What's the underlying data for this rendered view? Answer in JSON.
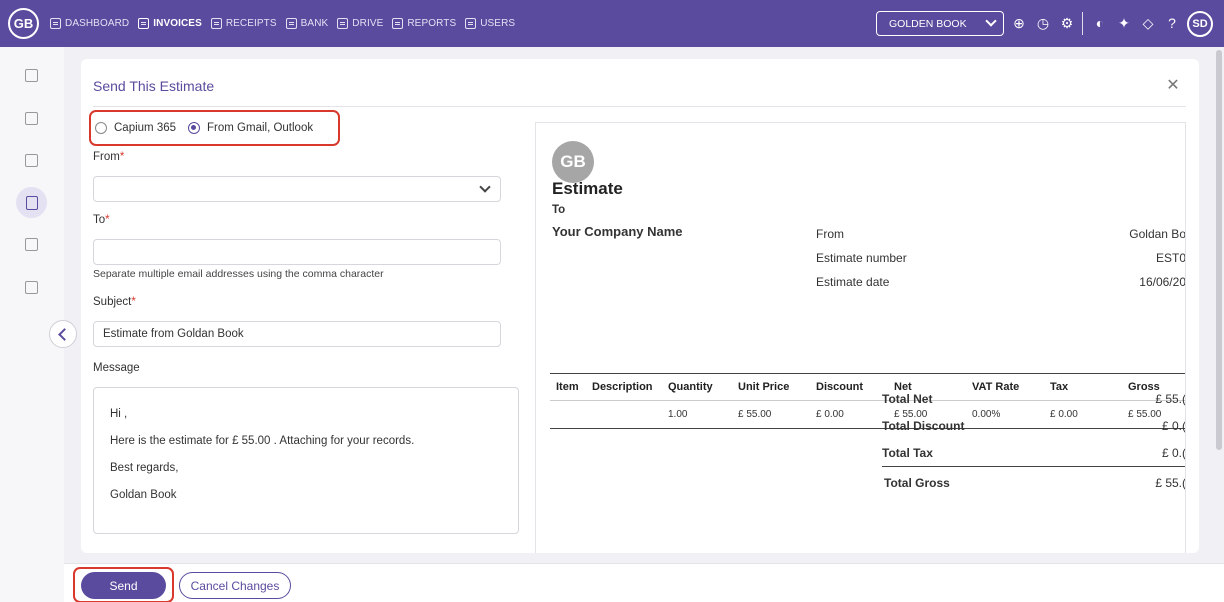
{
  "app": {
    "logo": "GB",
    "avatar": "SD",
    "company": "GOLDEN BOOK"
  },
  "nav": [
    {
      "label": "DASHBOARD",
      "icon": "grid-icon"
    },
    {
      "label": "INVOICES",
      "icon": "invoice-icon"
    },
    {
      "label": "RECEIPTS",
      "icon": "receipt-icon"
    },
    {
      "label": "BANK",
      "icon": "bank-icon"
    },
    {
      "label": "DRIVE",
      "icon": "drive-icon"
    },
    {
      "label": "REPORTS",
      "icon": "reports-icon"
    },
    {
      "label": "USERS",
      "icon": "users-icon"
    }
  ],
  "dialog": {
    "title": "Send This Estimate",
    "radio_capium": "Capium 365",
    "radio_gmail": "From Gmail, Outlook",
    "from_label": "From",
    "to_label": "To",
    "to_hint": "Separate multiple email addresses using the comma character",
    "subject_label": "Subject",
    "subject_value": "Estimate from Goldan Book",
    "message_label": "Message",
    "message_lines": [
      "Hi ,",
      "Here is the estimate for £ 55.00 . Attaching for your records.",
      "Best regards,",
      "Goldan Book"
    ],
    "required_mark": "*"
  },
  "preview": {
    "logo": "GB",
    "title": "Estimate",
    "to": "To",
    "company": "Your Company Name",
    "from_label": "From",
    "from_value": "Goldan Bo",
    "number_label": "Estimate number",
    "number_value": "EST0",
    "date_label": "Estimate date",
    "date_value": "16/06/20",
    "columns": [
      "Item",
      "Description",
      "Quantity",
      "Unit Price",
      "Discount",
      "Net",
      "VAT Rate",
      "Tax",
      "Gross"
    ],
    "row": [
      "",
      "",
      "1.00",
      "£ 55.00",
      "£ 0.00",
      "£ 55.00",
      "0.00%",
      "£ 0.00",
      "£ 55.00"
    ],
    "totals": [
      {
        "label": "Total Net",
        "value": "£ 55.("
      },
      {
        "label": "Total Discount",
        "value": "£ 0.("
      },
      {
        "label": "Total Tax",
        "value": "£ 0.("
      },
      {
        "label": "Total Gross",
        "value": "£ 55.("
      }
    ]
  },
  "footer": {
    "send": "Send",
    "cancel": "Cancel Changes"
  },
  "colors": {
    "brand": "#5b4b9e",
    "highlight": "#d9382d"
  }
}
